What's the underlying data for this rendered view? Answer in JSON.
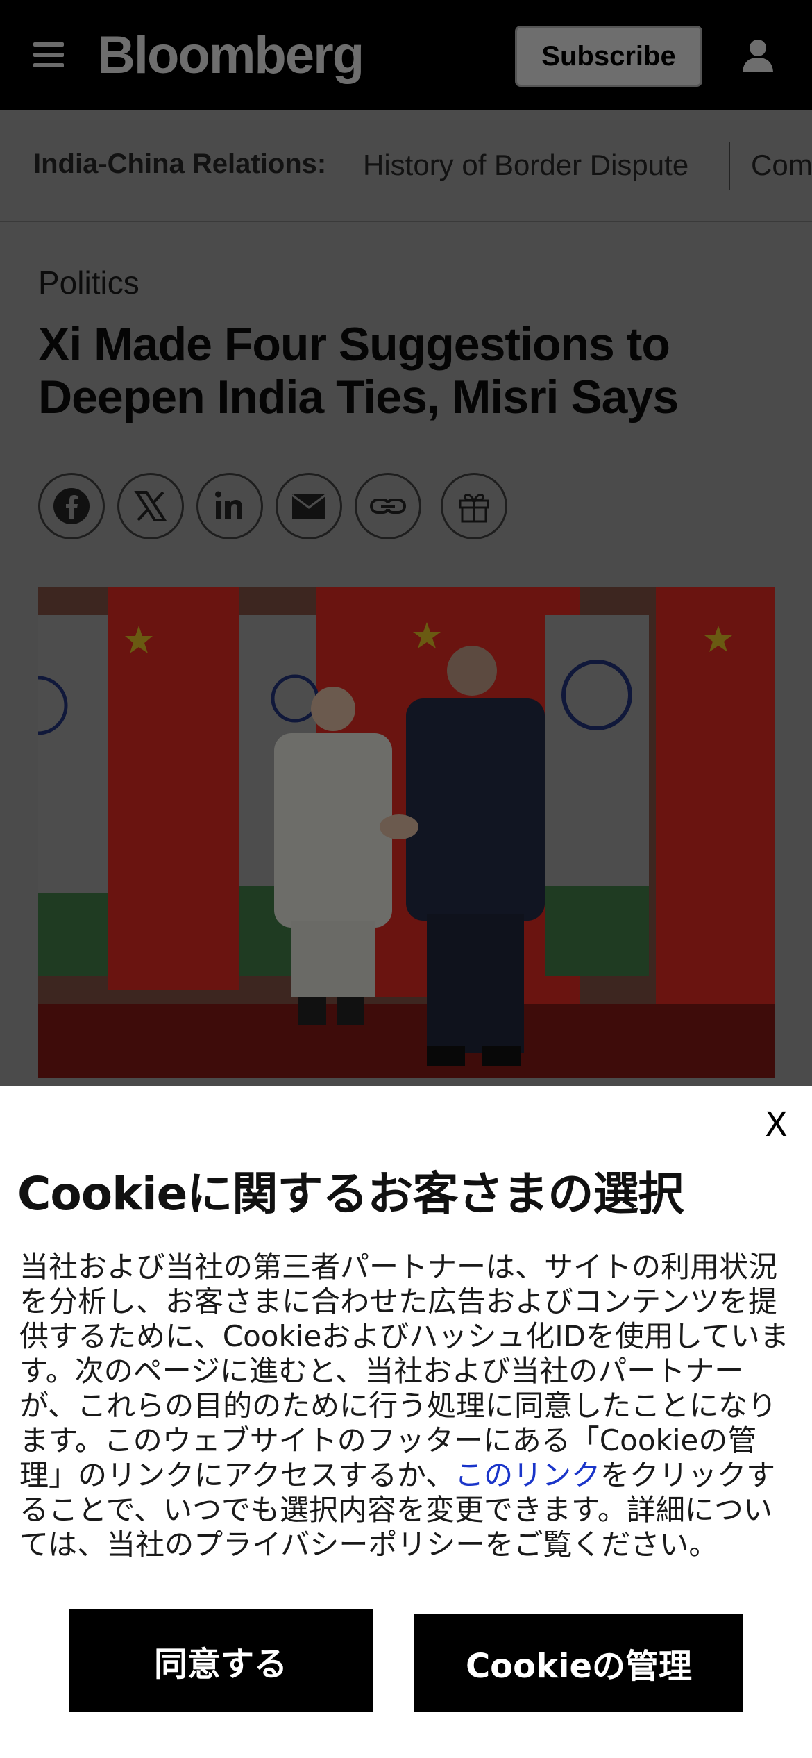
{
  "header": {
    "logo": "Bloomberg",
    "subscribe_label": "Subscribe",
    "menu_icon": "hamburger-menu-icon",
    "account_icon": "user-icon"
  },
  "subnav": {
    "title": "India-China Relations:",
    "links": [
      "History of Border Dispute",
      "Com"
    ]
  },
  "article": {
    "category": "Politics",
    "headline": "Xi Made Four Suggestions to Deepen India Ties, Misri Says",
    "share_icons": [
      "facebook-icon",
      "x-icon",
      "linkedin-icon",
      "email-icon",
      "link-icon",
      "gift-icon"
    ]
  },
  "cookie_banner": {
    "close_label": "X",
    "title": "Cookieに関するお客さまの選択",
    "body_before_link": "当社および当社の第三者パートナーは、サイトの利用状況を分析し、お客さまに合わせた広告およびコンテンツを提供するために、Cookieおよびハッシュ化IDを使用しています。次のページに進むと、当社および当社のパートナーが、これらの目的のために行う処理に同意したことになります。このウェブサイトのフッターにある「Cookieの管理」のリンクにアクセスするか、",
    "link_text": "このリンク",
    "body_after_link": "をクリックすることで、いつでも選択内容を変更できます。詳細については、当社のプライバシーポリシーをご覧ください。",
    "accept_label": "同意する",
    "manage_label": "Cookieの管理"
  },
  "colors": {
    "header_bg": "#000000",
    "overlay_bg": "#4b4b4b",
    "link": "#1a35c9",
    "button_bg": "#000000"
  }
}
